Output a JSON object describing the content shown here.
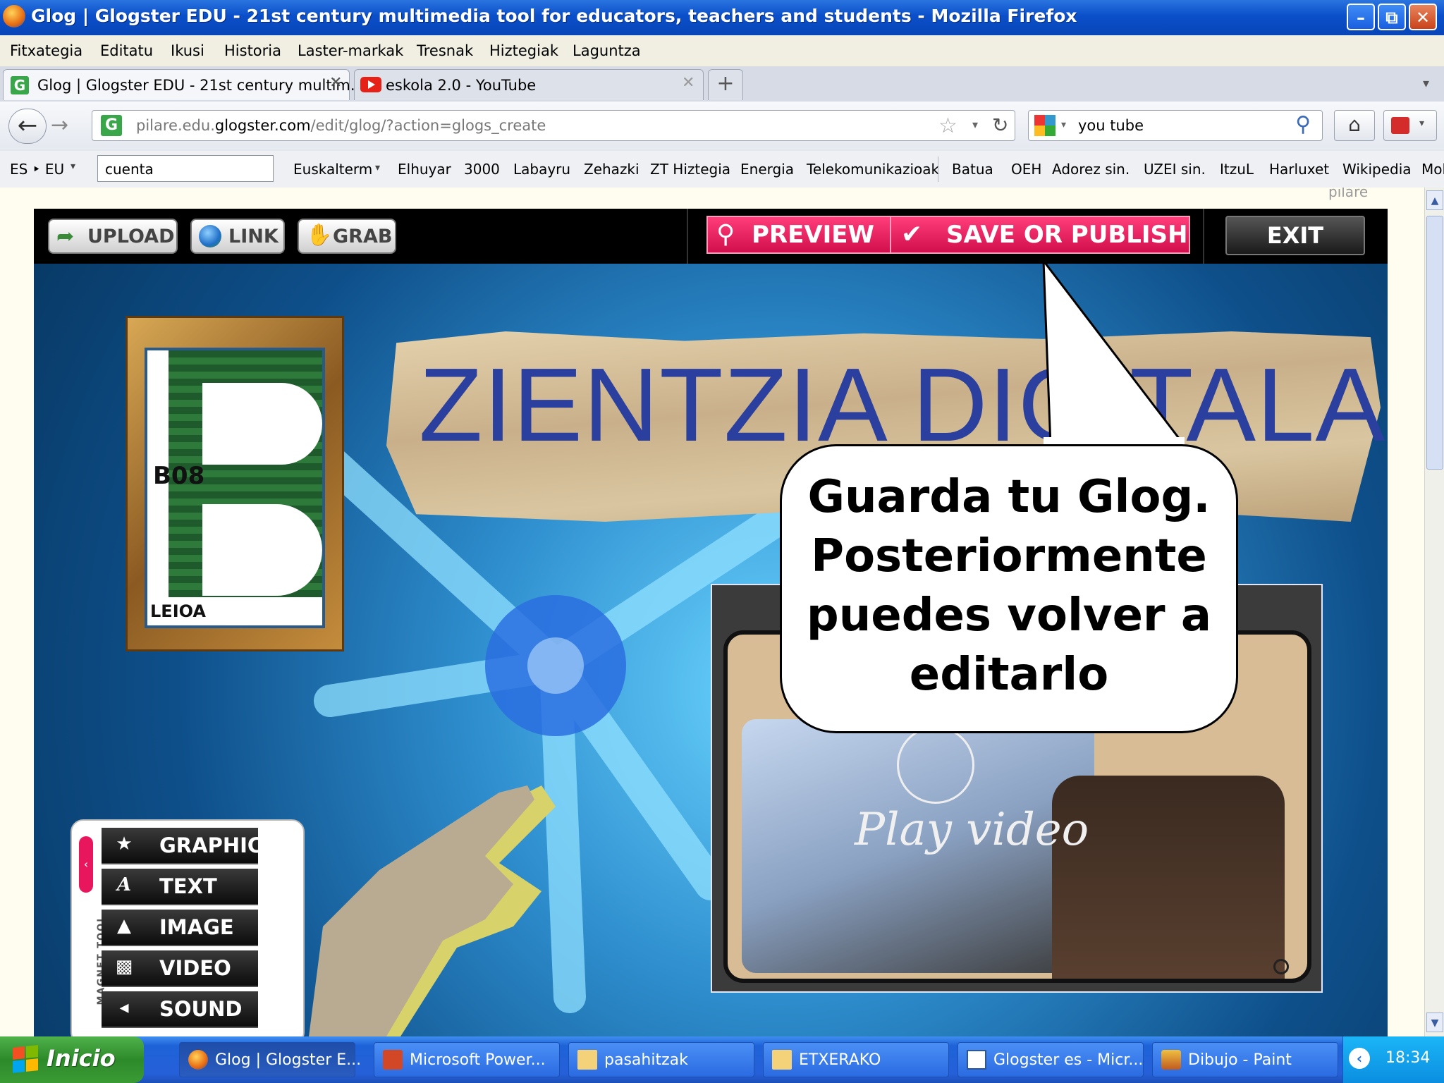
{
  "window": {
    "title": "Glog | Glogster EDU - 21st century multimedia tool for educators, teachers and students - Mozilla Firefox"
  },
  "menubar": [
    "Fitxategia",
    "Editatu",
    "Ikusi",
    "Historia",
    "Laster-markak",
    "Tresnak",
    "Hiztegiak",
    "Laguntza"
  ],
  "tabs": [
    {
      "label": "Glog | Glogster EDU - 21st century multim...",
      "active": true
    },
    {
      "label": "eskola 2.0 - YouTube",
      "active": false
    }
  ],
  "new_tab_label": "+",
  "navbar": {
    "url_prefix": "pilare.edu.",
    "url_domain": "glogster.com",
    "url_path": "/edit/glog/?action=glogs_create",
    "search_value": "you tube"
  },
  "bookmarks": {
    "lang": "ES ‣ EU",
    "search_value": "cuenta",
    "items": [
      "Euskalterm",
      "Elhuyar",
      "3000",
      "Labayru",
      "Zehazki",
      "ZT Hiztegia",
      "Energia",
      "Telekomunikazioak",
      "Batua",
      "OEH",
      "Adorez sin.",
      "UZEI sin.",
      "ItzuL",
      "Harluxet",
      "Wikipedia",
      "Mol"
    ]
  },
  "glogster": {
    "user": "pilare",
    "toolbar": {
      "upload": "UPLOAD",
      "link": "LINK",
      "grab": "GRAB",
      "preview": "PREVIEW",
      "save": "SAVE OR PUBLISH",
      "exit": "EXIT"
    },
    "headline": "ZIENTZIA DIGITALA",
    "logo": {
      "code": "B08",
      "place": "LEIOA"
    },
    "video_label": "Play video",
    "magnet_tool": {
      "label": "MAGNET TOOL",
      "items": [
        {
          "label": "GRAPHICS",
          "icon": "star-icon"
        },
        {
          "label": "TEXT",
          "icon": "text-icon"
        },
        {
          "label": "IMAGE",
          "icon": "image-icon"
        },
        {
          "label": "VIDEO",
          "icon": "video-icon"
        },
        {
          "label": "SOUND",
          "icon": "sound-icon"
        }
      ]
    }
  },
  "callout": {
    "lines": [
      "Guarda tu Glog.",
      "Posteriormente",
      "puedes volver a",
      "editarlo"
    ]
  },
  "taskbar": {
    "start": "Inicio",
    "tasks": [
      "Glog | Glogster E...",
      "Microsoft Power...",
      "pasahitzak",
      "ETXERAKO",
      "Glogster es - Micr...",
      "Dibujo - Paint"
    ],
    "clock": "18:34"
  },
  "colors": {
    "accent_pink": "#e8175d",
    "headline_blue": "#2b3f9e",
    "xp_blue": "#245edb"
  }
}
